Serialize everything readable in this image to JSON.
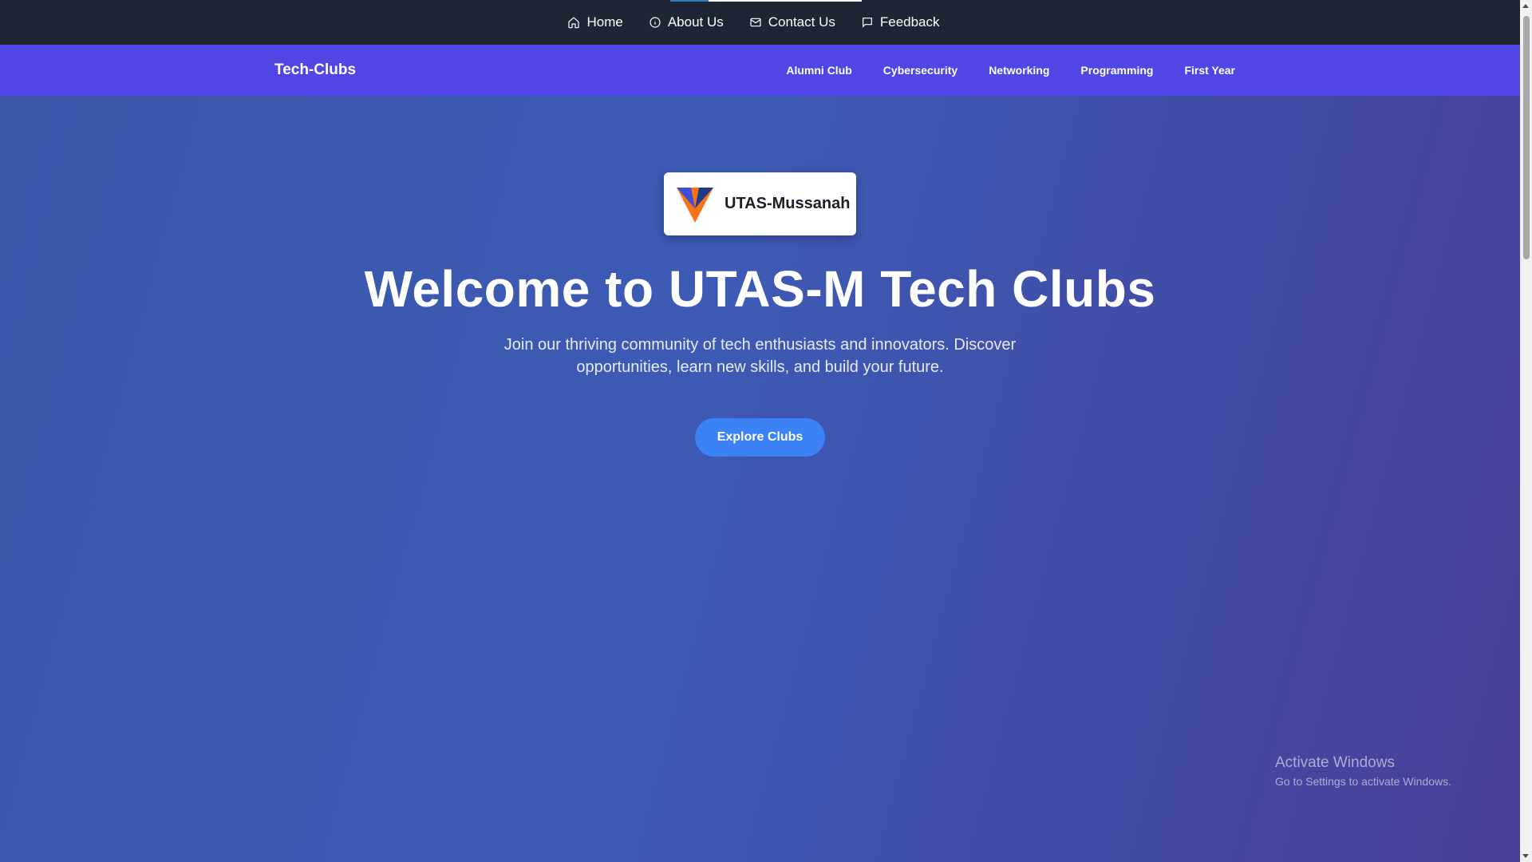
{
  "top_nav": {
    "items": [
      {
        "label": "Home",
        "icon": "home-icon"
      },
      {
        "label": "About Us",
        "icon": "info-icon"
      },
      {
        "label": "Contact Us",
        "icon": "mail-icon"
      },
      {
        "label": "Feedback",
        "icon": "message-icon"
      }
    ]
  },
  "main_nav": {
    "brand": "Tech-Clubs",
    "items": [
      "Alumni Club",
      "Cybersecurity",
      "Networking",
      "Programming",
      "First Year"
    ]
  },
  "hero": {
    "logo_text": "UTAS-Mussanah",
    "title": "Welcome to UTAS-M Tech Clubs",
    "subtitle_line1": "Join our thriving community of tech enthusiasts and innovators. Discover",
    "subtitle_line2": "opportunities, learn new skills, and build your future.",
    "cta_label": "Explore Clubs"
  },
  "watermark": {
    "title": "Activate Windows",
    "subtitle": "Go to Settings to activate Windows."
  },
  "colors": {
    "topbar_bg": "#1e2535",
    "mainnav_bg": "#4f46e5",
    "cta_bg": "#3b82f6",
    "logo_orange": "#f97316",
    "logo_blue": "#3b4fd8"
  }
}
